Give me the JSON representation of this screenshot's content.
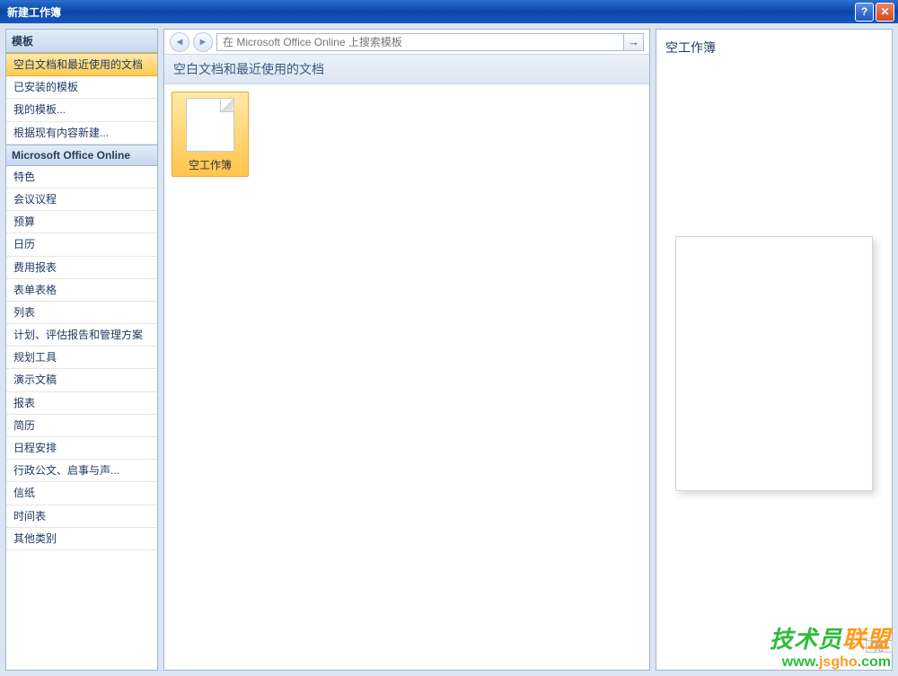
{
  "window": {
    "title": "新建工作簿"
  },
  "sidebar": {
    "header": "模板",
    "items_top": [
      {
        "label": "空白文档和最近使用的文档",
        "selected": true
      },
      {
        "label": "已安装的模板",
        "selected": false
      },
      {
        "label": "我的模板...",
        "selected": false
      },
      {
        "label": "根据现有内容新建...",
        "selected": false
      }
    ],
    "section_label": "Microsoft Office Online",
    "items_online": [
      {
        "label": "特色"
      },
      {
        "label": "会议议程"
      },
      {
        "label": "预算"
      },
      {
        "label": "日历"
      },
      {
        "label": "费用报表"
      },
      {
        "label": "表单表格"
      },
      {
        "label": "列表"
      },
      {
        "label": "计划、评估报告和管理方案"
      },
      {
        "label": "规划工具"
      },
      {
        "label": "演示文稿"
      },
      {
        "label": "报表"
      },
      {
        "label": "简历"
      },
      {
        "label": "日程安排"
      },
      {
        "label": "行政公文、启事与声..."
      },
      {
        "label": "信纸"
      },
      {
        "label": "时间表"
      },
      {
        "label": "其他类别"
      }
    ]
  },
  "toolbar": {
    "search_placeholder": "在 Microsoft Office Online 上搜索模板",
    "go_glyph": "→"
  },
  "main": {
    "heading": "空白文档和最近使用的文档",
    "template_label": "空工作簿"
  },
  "preview": {
    "title": "空工作簿"
  },
  "watermark": {
    "line1_a": "技术员",
    "line1_b": "联盟",
    "line2_a": "www.",
    "line2_b": "jsgho",
    "line2_c": ".com"
  },
  "footer_hint": "用"
}
